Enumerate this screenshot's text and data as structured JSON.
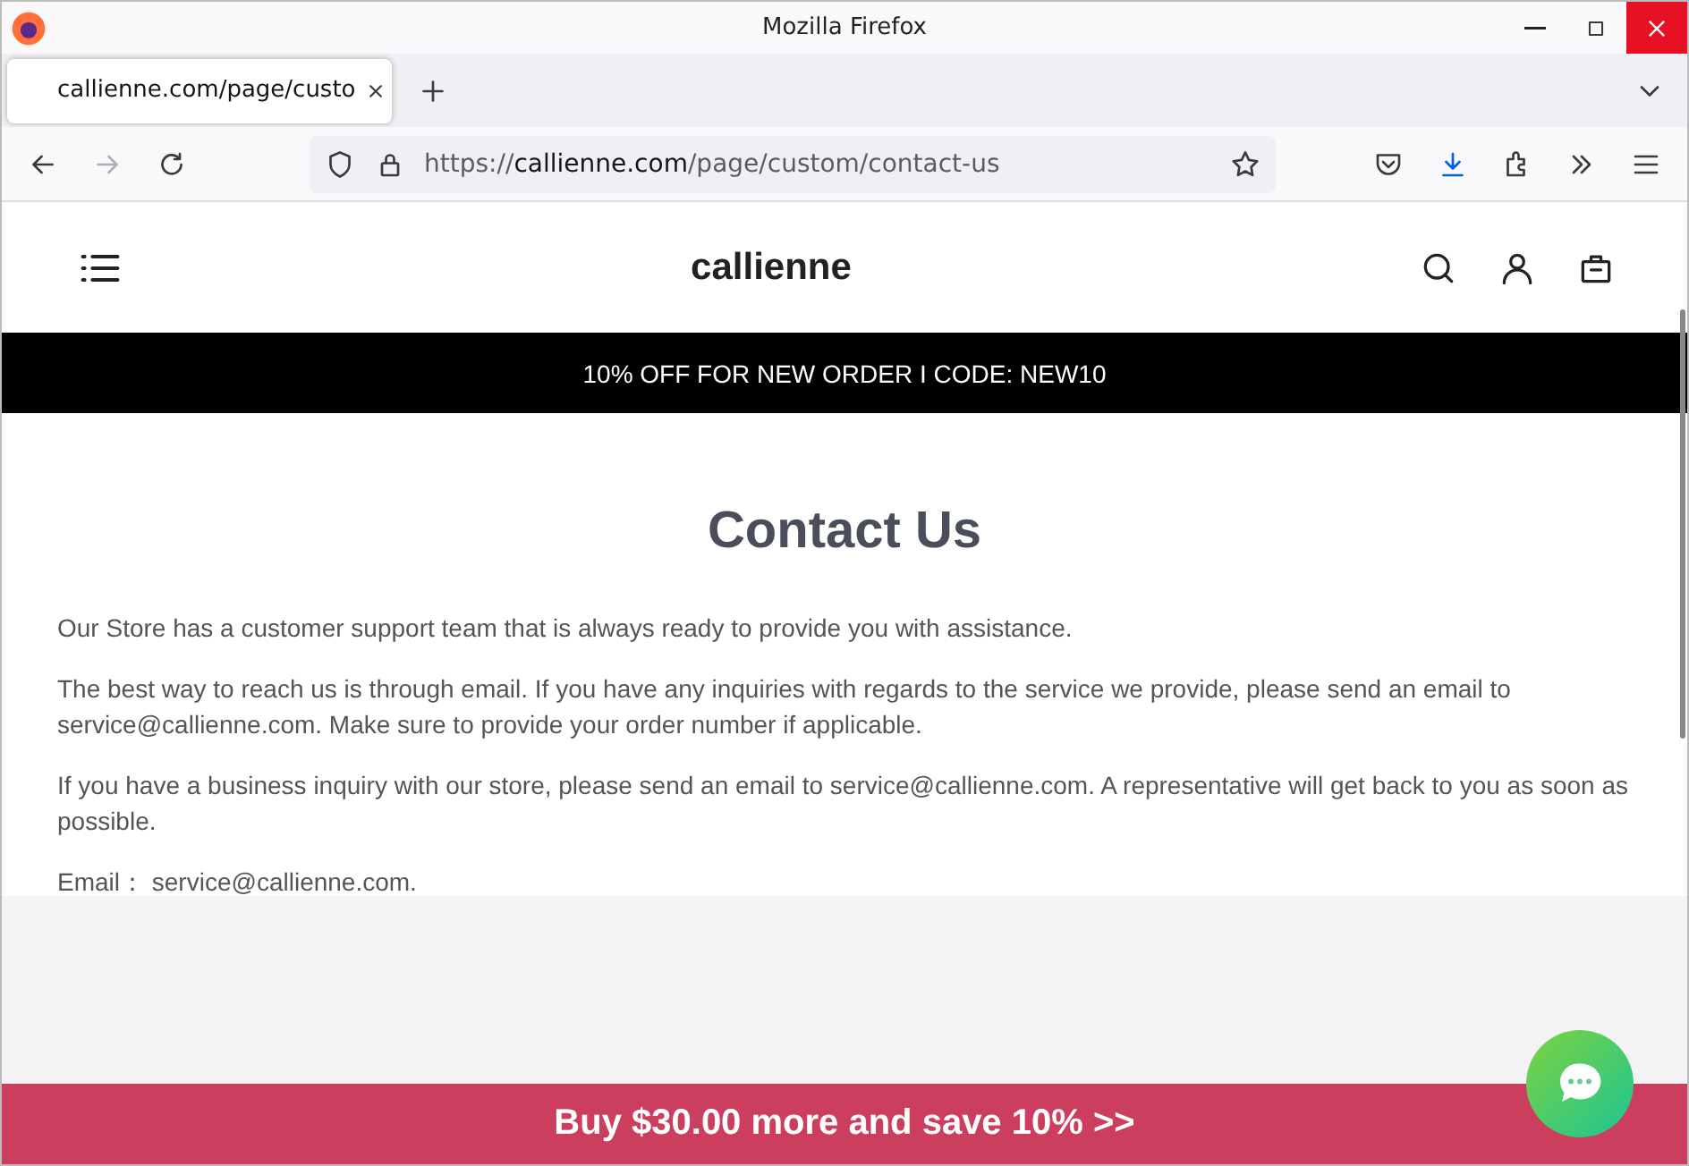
{
  "window": {
    "title": "Mozilla Firefox"
  },
  "tab": {
    "label": "callienne.com/page/custo",
    "selected": true
  },
  "address": {
    "scheme": "https://",
    "domain": "callienne.com",
    "path": "/page/custom/contact-us"
  },
  "site": {
    "logo": "callienne",
    "promo": "10% OFF FOR NEW ORDER I CODE: NEW10"
  },
  "page": {
    "heading": "Contact Us",
    "paragraphs": [
      "Our Store has a customer support team that is always ready to provide you with assistance.",
      "The best way to reach us is through email. If you have any inquiries with regards to the service we provide, please send an email to service@callienne.com. Make sure to provide your order number if applicable.",
      "If you have a business inquiry with our store, please send an email to service@callienne.com. A representative will get back to you as soon as possible.",
      "Email：  service@callienne.com."
    ]
  },
  "bottom_bar": {
    "label": "Buy $30.00 more and save 10%  >>"
  }
}
